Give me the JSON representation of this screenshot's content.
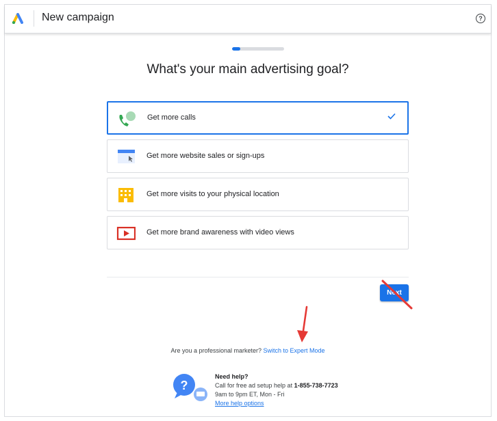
{
  "header": {
    "title": "New campaign"
  },
  "progress": {
    "fraction": 0.16
  },
  "heading": "What's your main advertising goal?",
  "options": [
    {
      "label": "Get more calls",
      "icon": "phone-icon",
      "selected": true
    },
    {
      "label": "Get more website sales or sign-ups",
      "icon": "website-icon",
      "selected": false
    },
    {
      "label": "Get more visits to your physical location",
      "icon": "store-icon",
      "selected": false
    },
    {
      "label": "Get more brand awareness with video views",
      "icon": "video-icon",
      "selected": false
    }
  ],
  "next_label": "Next",
  "pro": {
    "question": "Are you a professional marketer? ",
    "link": "Switch to Expert Mode"
  },
  "help": {
    "title": "Need help?",
    "call_prefix": "Call for free ad setup help at ",
    "phone": "1-855-738-7723",
    "hours": "9am to 9pm ET, Mon - Fri",
    "more_link": "More help options"
  },
  "colors": {
    "accent": "#1a73e8",
    "annotation": "#e53935"
  }
}
